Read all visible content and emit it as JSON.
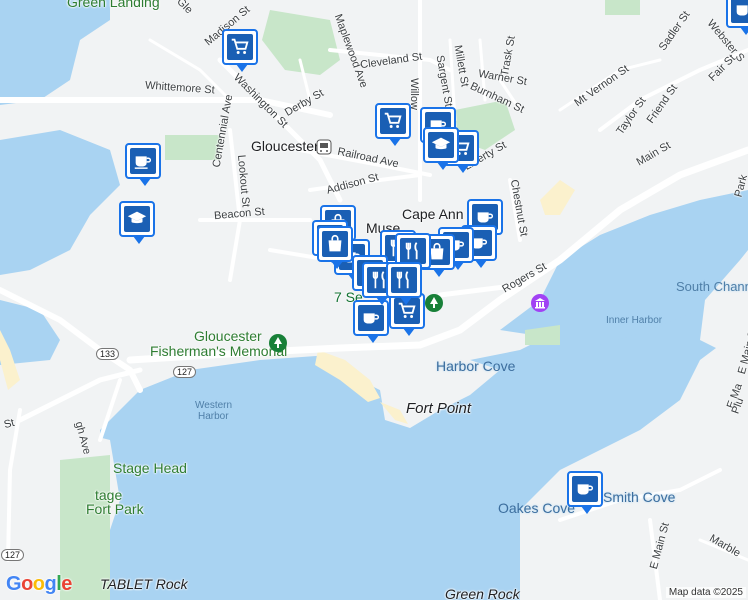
{
  "streets": [
    {
      "id": "madison-st",
      "text": "Madison St"
    },
    {
      "id": "washington-st",
      "text": "Washington St"
    },
    {
      "id": "whittemore-st",
      "text": "Whittemore St"
    },
    {
      "id": "derby-st",
      "text": "Derby St"
    },
    {
      "id": "maplewood-ave",
      "text": "Maplewood Ave"
    },
    {
      "id": "cleveland-st",
      "text": "Cleveland St"
    },
    {
      "id": "willow-st",
      "text": "Willow"
    },
    {
      "id": "sargent-st",
      "text": "Sargent St"
    },
    {
      "id": "millett-st",
      "text": "Millett St"
    },
    {
      "id": "trask-st",
      "text": "Trask St"
    },
    {
      "id": "warner-st",
      "text": "Warner St"
    },
    {
      "id": "burnham-st",
      "text": "Burnham St"
    },
    {
      "id": "mt-vernon-st",
      "text": "Mt Vernon St"
    },
    {
      "id": "sadler-st",
      "text": "Sadler St"
    },
    {
      "id": "webster-st",
      "text": "Webster S"
    },
    {
      "id": "fair-st",
      "text": "Fair St"
    },
    {
      "id": "taylor-st",
      "text": "Taylor St"
    },
    {
      "id": "friend-st",
      "text": "Friend St"
    },
    {
      "id": "main-st",
      "text": "Main St"
    },
    {
      "id": "centennial-ave",
      "text": "Centennial Ave"
    },
    {
      "id": "railroad-ave",
      "text": "Railroad Ave"
    },
    {
      "id": "lookout-st",
      "text": "Lookout St"
    },
    {
      "id": "addison-st",
      "text": "Addison St"
    },
    {
      "id": "liberty-st",
      "text": "Liberty St"
    },
    {
      "id": "beacon-st",
      "text": "Beacon St"
    },
    {
      "id": "chestnut-st",
      "text": "Chestnut St"
    },
    {
      "id": "rogers-st",
      "text": "Rogers St"
    },
    {
      "id": "e-main-st",
      "text": "E Main St"
    },
    {
      "id": "e-main-st-2",
      "text": "E Main St"
    },
    {
      "id": "high-ave",
      "text": "gh Ave"
    },
    {
      "id": "marble",
      "text": "Marble"
    },
    {
      "id": "e-ma",
      "text": "E Ma"
    },
    {
      "id": "plu",
      "text": "Plu"
    },
    {
      "id": "park",
      "text": "Park"
    },
    {
      "id": "s-left",
      "text": "St"
    },
    {
      "id": "gle",
      "text": "Gle"
    }
  ],
  "places": [
    {
      "id": "gloucester",
      "text": "Gloucester"
    },
    {
      "id": "cape-ann",
      "text": "Cape Ann"
    },
    {
      "id": "museum",
      "text": "Muse"
    },
    {
      "id": "seven-seas",
      "text": "7 Se"
    },
    {
      "id": "fishermans-memorial-1",
      "text": "Gloucester"
    },
    {
      "id": "fishermans-memorial-2",
      "text": "Fisherman's Memorial"
    },
    {
      "id": "harbor-cove",
      "text": "Harbor Cove"
    },
    {
      "id": "fort-point",
      "text": "Fort Point"
    },
    {
      "id": "stage-head",
      "text": "Stage Head"
    },
    {
      "id": "stage-fort-park-1",
      "text": "tage"
    },
    {
      "id": "stage-fort-park-2",
      "text": "Fort Park"
    },
    {
      "id": "oakes-cove",
      "text": "Oakes Cove"
    },
    {
      "id": "smith-cove",
      "text": "Smith Cove"
    },
    {
      "id": "tablet-rock",
      "text": "TABLET Rock"
    },
    {
      "id": "green-rock",
      "text": "Green Rock"
    },
    {
      "id": "green-landing",
      "text": "Green Landing"
    }
  ],
  "water": [
    {
      "id": "western-harbor-1",
      "text": "Western"
    },
    {
      "id": "western-harbor-2",
      "text": "Harbor"
    },
    {
      "id": "inner-harbor",
      "text": "Inner Harbor"
    },
    {
      "id": "south-channel",
      "text": "South Channe"
    }
  ],
  "shields": [
    {
      "id": "route-133",
      "text": "133"
    },
    {
      "id": "route-127",
      "text": "127"
    },
    {
      "id": "route-127-b",
      "text": "127"
    }
  ],
  "icons": {
    "shopping": "shopping-cart-icon",
    "cafe": "coffee-cup-icon",
    "school": "graduation-cap-icon",
    "restaurant": "fork-knife-icon",
    "store": "shopping-bag-icon",
    "park": "tree-icon",
    "museum": "museum-icon",
    "transit": "train-icon"
  },
  "colors": {
    "water": "#a9d3f2",
    "land": "#f1f3f4",
    "park": "#c8e6c9",
    "beach": "#fbf1cd",
    "marker": "#1a5fb4",
    "road": "#ffffff"
  },
  "google_logo": "Google",
  "attribution": "Map data ©2025"
}
